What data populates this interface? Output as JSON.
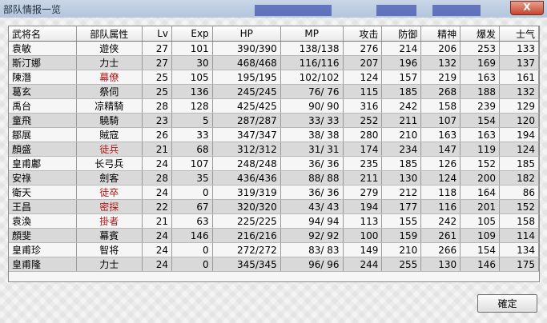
{
  "window": {
    "title": "部队情报一览",
    "close_label": "X"
  },
  "table": {
    "headers": [
      "武将名",
      "部队属性",
      "Lv",
      "Exp",
      "HP",
      "MP",
      "攻击",
      "防御",
      "精神",
      "爆发",
      "士气"
    ],
    "rows": [
      [
        "袁敏",
        "遊侠",
        "27",
        "101",
        "390/390",
        "138/138",
        "276",
        "214",
        "206",
        "253",
        "133"
      ],
      [
        "斯汀娜",
        "力士",
        "27",
        "30",
        "468/468",
        "116/116",
        "207",
        "196",
        "132",
        "169",
        "137"
      ],
      [
        "陳潛",
        "幕僚",
        "25",
        "105",
        "195/195",
        "102/102",
        "124",
        "157",
        "219",
        "163",
        "161"
      ],
      [
        "葛玄",
        "祭伺",
        "25",
        "136",
        "245/245",
        "76/ 76",
        "115",
        "185",
        "268",
        "188",
        "132"
      ],
      [
        "禹台",
        "凉精騎",
        "28",
        "128",
        "425/425",
        "90/ 90",
        "316",
        "242",
        "158",
        "239",
        "129"
      ],
      [
        "童飛",
        "驍騎",
        "23",
        "5",
        "287/287",
        "33/ 33",
        "252",
        "211",
        "107",
        "154",
        "120"
      ],
      [
        "鄒展",
        "賊寇",
        "26",
        "33",
        "347/347",
        "38/ 38",
        "280",
        "210",
        "163",
        "163",
        "194"
      ],
      [
        "顏盛",
        "徒兵",
        "21",
        "68",
        "312/312",
        "31/ 31",
        "174",
        "234",
        "147",
        "119",
        "124"
      ],
      [
        "皇甫鄘",
        "长弓兵",
        "24",
        "107",
        "248/248",
        "36/ 36",
        "235",
        "185",
        "126",
        "152",
        "185"
      ],
      [
        "安祿",
        "劍客",
        "28",
        "35",
        "436/436",
        "88/ 88",
        "211",
        "130",
        "124",
        "200",
        "182"
      ],
      [
        "衛天",
        "徒卒",
        "24",
        "0",
        "319/319",
        "36/ 36",
        "279",
        "212",
        "118",
        "164",
        "86"
      ],
      [
        "王昌",
        "密探",
        "22",
        "67",
        "320/320",
        "43/ 43",
        "194",
        "177",
        "116",
        "201",
        "152"
      ],
      [
        "袁渙",
        "掛者",
        "21",
        "63",
        "225/225",
        "94/ 94",
        "113",
        "155",
        "242",
        "105",
        "158"
      ],
      [
        "顏斐",
        "幕賓",
        "24",
        "146",
        "216/216",
        "92/ 92",
        "100",
        "159",
        "261",
        "109",
        "114"
      ],
      [
        "皇甫珍",
        "智将",
        "24",
        "0",
        "272/272",
        "83/ 83",
        "149",
        "210",
        "266",
        "154",
        "134"
      ],
      [
        "皇甫隆",
        "力士",
        "24",
        "0",
        "345/345",
        "96/ 96",
        "244",
        "255",
        "130",
        "146",
        "175"
      ]
    ],
    "red_attr_rows": [
      2,
      7,
      10,
      11,
      12
    ]
  },
  "buttons": {
    "ok_label": "確定"
  }
}
